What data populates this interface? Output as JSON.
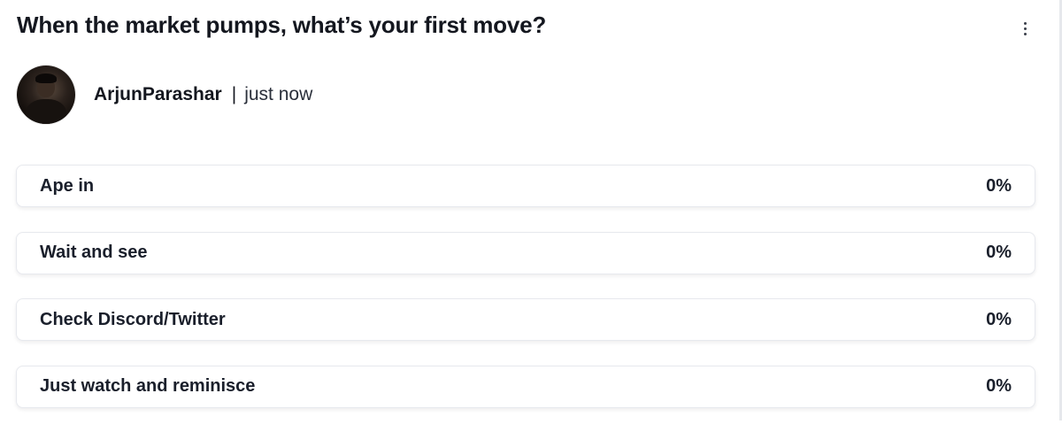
{
  "poll": {
    "title": "When the market pumps, what’s your first move?",
    "more_icon": "more-vertical-icon",
    "author": {
      "name": "ArjunParashar",
      "separator": "|",
      "timestamp": "just now",
      "avatar_icon": "user-avatar"
    },
    "options": [
      {
        "label": "Ape in",
        "percent_text": "0%",
        "percent": 0
      },
      {
        "label": "Wait and see",
        "percent_text": "0%",
        "percent": 0
      },
      {
        "label": "Check Discord/Twitter",
        "percent_text": "0%",
        "percent": 0
      },
      {
        "label": "Just watch and reminisce",
        "percent_text": "0%",
        "percent": 0
      }
    ]
  },
  "colors": {
    "text": "#1a1f2b",
    "option_border": "#e7e9ee",
    "option_fill": "#eef0f4"
  }
}
